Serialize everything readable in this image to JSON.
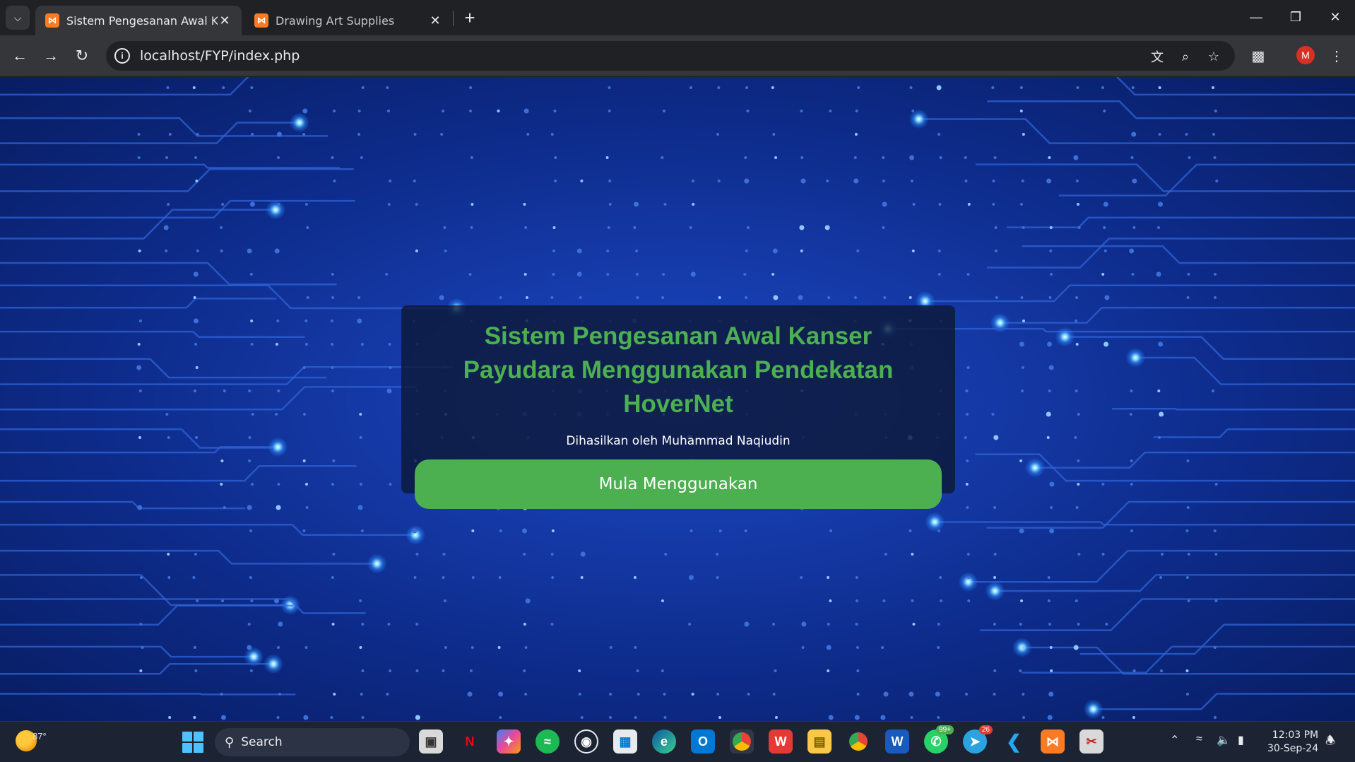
{
  "browser": {
    "tabs": [
      {
        "title": "Sistem Pengesanan Awal Kanser Payudara",
        "active": true
      },
      {
        "title": "Drawing Art Supplies",
        "active": false
      }
    ],
    "url": "localhost/FYP/index.php",
    "profile_initial": "M"
  },
  "page": {
    "title_line1": "Sistem Pengesanan Awal Kanser",
    "title_line2": "Payudara Menggunakan Pendekatan HoverNet",
    "author": "Dihasilkan oleh Muhammad Naqiudin",
    "start_button": "Mula Menggunakan",
    "accent_color": "#4caf50",
    "background_theme": "blue circuit board"
  },
  "taskbar": {
    "weather_temp": "87°",
    "search_placeholder": "Search",
    "whatsapp_badge": "99+",
    "telegram_badge": "26",
    "time": "12:03 PM",
    "date": "30-Sep-24"
  }
}
